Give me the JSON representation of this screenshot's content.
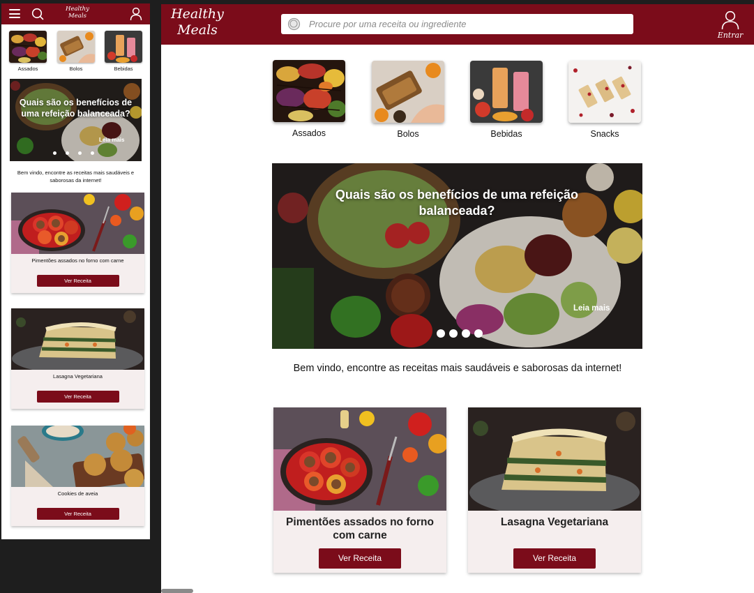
{
  "brand": {
    "line1": "Healthy",
    "line2": "Meals",
    "primary_color": "#7b0c1a",
    "card_bg": "#f5eeee"
  },
  "mobile": {
    "header": {
      "menu_icon": "hamburger-icon",
      "search_icon": "search-icon",
      "user_icon": "user-icon"
    },
    "categories": [
      {
        "label": "Assados"
      },
      {
        "label": "Bolos"
      },
      {
        "label": "Bebidas"
      }
    ],
    "banner": {
      "title": "Quais são os benefícios de uma refeição balanceada?",
      "cta": "Leia mais",
      "dots": 4
    },
    "welcome": "Bem vindo, encontre as receitas mais saudáveis e saborosas da internet!",
    "recipes": [
      {
        "title": "Pimentões assados no forno com carne",
        "button": "Ver Receita"
      },
      {
        "title": "Lasagna Vegetariana",
        "button": "Ver Receita"
      },
      {
        "title": "Cookies de aveia",
        "button": "Ver Receita"
      }
    ]
  },
  "desktop": {
    "header": {
      "search_placeholder": "Procure por uma receita ou ingrediente",
      "login_label": "Entrar",
      "search_icon": "search-icon",
      "user_icon": "user-icon"
    },
    "categories": [
      {
        "label": "Assados"
      },
      {
        "label": "Bolos"
      },
      {
        "label": "Bebidas"
      },
      {
        "label": "Snacks"
      }
    ],
    "banner": {
      "title": "Quais são os benefícios de uma refeição balanceada?",
      "cta": "Leia mais",
      "dots": 4
    },
    "welcome": "Bem vindo, encontre as receitas mais saudáveis e saborosas da internet!",
    "recipes": [
      {
        "title": "Pimentões assados no forno com carne",
        "button": "Ver Receita"
      },
      {
        "title": "Lasagna Vegetariana",
        "button": "Ver Receita"
      }
    ]
  }
}
